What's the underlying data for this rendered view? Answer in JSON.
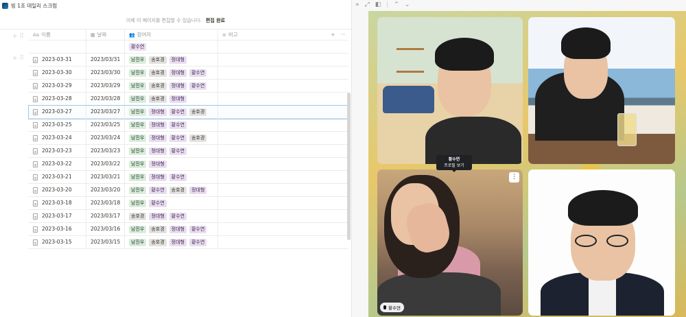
{
  "app": {
    "page_title": "빙 1조 데일리 스크럼"
  },
  "editbar": {
    "message": "이제 이 페이지를 편집할 수 있습니다.",
    "done_label": "편집 완료"
  },
  "table": {
    "columns": {
      "name": "이름",
      "date": "날짜",
      "attendees": "참여자",
      "note": "비고"
    },
    "rows": [
      {
        "name": "",
        "date": "",
        "tags": [
          {
            "text": "황수연",
            "color": "purple"
          }
        ]
      },
      {
        "name": "2023-03-31",
        "date": "2023/03/31",
        "tags": [
          {
            "text": "남진우",
            "color": "green"
          },
          {
            "text": "송호경",
            "color": "gray"
          },
          {
            "text": "정대형",
            "color": "purple"
          }
        ]
      },
      {
        "name": "2023-03-30",
        "date": "2023/03/30",
        "tags": [
          {
            "text": "남진우",
            "color": "green"
          },
          {
            "text": "송호경",
            "color": "gray"
          },
          {
            "text": "정대형",
            "color": "purple"
          },
          {
            "text": "황수연",
            "color": "purple"
          }
        ]
      },
      {
        "name": "2023-03-29",
        "date": "2023/03/29",
        "tags": [
          {
            "text": "남진우",
            "color": "green"
          },
          {
            "text": "송호경",
            "color": "gray"
          },
          {
            "text": "정대형",
            "color": "purple"
          },
          {
            "text": "황수연",
            "color": "purple"
          }
        ]
      },
      {
        "name": "2023-03-28",
        "date": "2023/03/28",
        "tags": [
          {
            "text": "남진우",
            "color": "green"
          },
          {
            "text": "송호경",
            "color": "gray"
          },
          {
            "text": "정대형",
            "color": "purple"
          }
        ]
      },
      {
        "name": "2023-03-27",
        "date": "2023/03/27",
        "selected": true,
        "tags": [
          {
            "text": "남진우",
            "color": "green"
          },
          {
            "text": "정대형",
            "color": "purple"
          },
          {
            "text": "황수연",
            "color": "purple"
          },
          {
            "text": "송호경",
            "color": "gray"
          }
        ]
      },
      {
        "name": "2023-03-25",
        "date": "2023/03/25",
        "tags": [
          {
            "text": "남진우",
            "color": "green"
          },
          {
            "text": "정대형",
            "color": "purple"
          },
          {
            "text": "황수연",
            "color": "purple"
          }
        ]
      },
      {
        "name": "2023-03-24",
        "date": "2023/03/24",
        "tags": [
          {
            "text": "남진우",
            "color": "green"
          },
          {
            "text": "정대형",
            "color": "purple"
          },
          {
            "text": "황수연",
            "color": "purple"
          },
          {
            "text": "송호경",
            "color": "gray"
          }
        ]
      },
      {
        "name": "2023-03-23",
        "date": "2023/03/23",
        "tags": [
          {
            "text": "남진우",
            "color": "green"
          },
          {
            "text": "정대형",
            "color": "purple"
          },
          {
            "text": "황수연",
            "color": "purple"
          }
        ]
      },
      {
        "name": "2023-03-22",
        "date": "2023/03/22",
        "tags": [
          {
            "text": "남진우",
            "color": "green"
          },
          {
            "text": "정대형",
            "color": "purple"
          }
        ]
      },
      {
        "name": "2023-03-21",
        "date": "2023/03/21",
        "tags": [
          {
            "text": "남진우",
            "color": "green"
          },
          {
            "text": "정대형",
            "color": "purple"
          },
          {
            "text": "황수연",
            "color": "purple"
          }
        ]
      },
      {
        "name": "2023-03-20",
        "date": "2023/03/20",
        "tags": [
          {
            "text": "남진우",
            "color": "green"
          },
          {
            "text": "황수연",
            "color": "purple"
          },
          {
            "text": "송호경",
            "color": "gray"
          },
          {
            "text": "정대형",
            "color": "purple"
          }
        ]
      },
      {
        "name": "2023-03-18",
        "date": "2023/03/18",
        "tags": [
          {
            "text": "남진우",
            "color": "green"
          },
          {
            "text": "황수연",
            "color": "purple"
          }
        ]
      },
      {
        "name": "2023-03-17",
        "date": "2023/03/17",
        "tags": [
          {
            "text": "송호경",
            "color": "gray"
          },
          {
            "text": "정대형",
            "color": "purple"
          },
          {
            "text": "황수연",
            "color": "purple"
          }
        ]
      },
      {
        "name": "2023-03-16",
        "date": "2023/03/16",
        "tags": [
          {
            "text": "남진우",
            "color": "green"
          },
          {
            "text": "송호경",
            "color": "gray"
          },
          {
            "text": "정대형",
            "color": "purple"
          },
          {
            "text": "황수연",
            "color": "purple"
          }
        ]
      },
      {
        "name": "2023-03-15",
        "date": "2023/03/15",
        "tags": [
          {
            "text": "남진우",
            "color": "green"
          },
          {
            "text": "송호경",
            "color": "gray"
          },
          {
            "text": "정대형",
            "color": "purple"
          },
          {
            "text": "황수연",
            "color": "purple"
          }
        ]
      }
    ]
  },
  "video": {
    "tooltip": {
      "name": "황수연",
      "action": "프로필 보기"
    },
    "tile3_label": "황수연",
    "more_icon": "more-vertical-icon"
  }
}
